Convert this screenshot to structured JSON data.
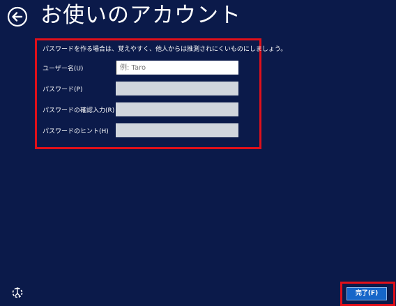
{
  "header": {
    "title": "お使いのアカウント",
    "back_icon": "back-arrow-circle-icon"
  },
  "form": {
    "instruction": "パスワードを作る場合は、覚えやすく、他人からは推測されにくいものにしましょう。",
    "fields": [
      {
        "label": "ユーザー名(U)",
        "value": "",
        "placeholder": "例: Taro"
      },
      {
        "label": "パスワード(P)",
        "value": "",
        "placeholder": ""
      },
      {
        "label": "パスワードの確認入力(R)",
        "value": "",
        "placeholder": ""
      },
      {
        "label": "パスワードのヒント(H)",
        "value": "",
        "placeholder": ""
      }
    ]
  },
  "footer": {
    "ease_access_icon": "ease-of-access-icon",
    "finish_label": "完了(F)"
  },
  "colors": {
    "background": "#0b1a4a",
    "highlight": "#e0101a",
    "finish_button": "#1666c9",
    "input_disabled": "#d1d6dd"
  }
}
